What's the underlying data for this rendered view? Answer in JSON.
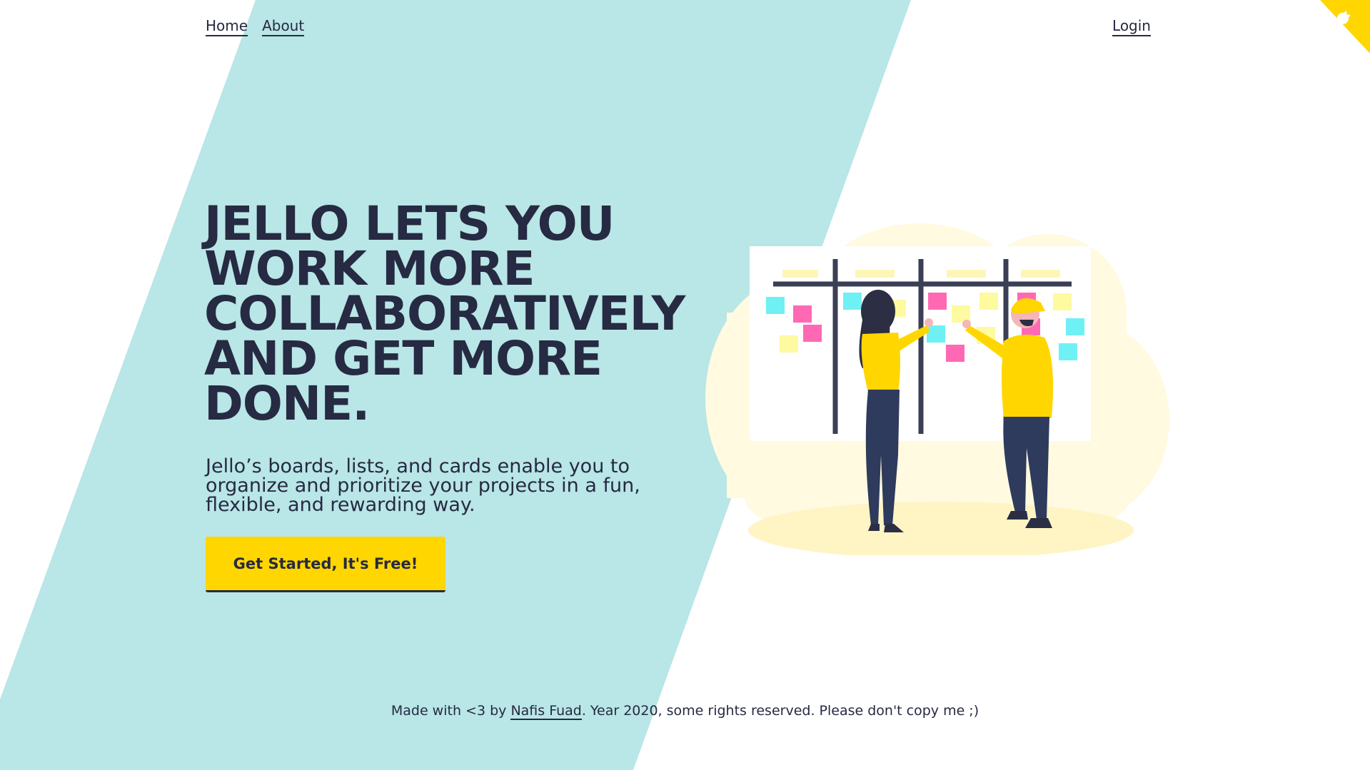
{
  "nav": {
    "home": "Home",
    "about": "About",
    "login": "Login"
  },
  "hero": {
    "title": "JELLO LETS YOU WORK MORE COLLABORATIVELY AND GET MORE DONE.",
    "description": "Jello’s boards, lists, and cards enable you to organize and prioritize your projects in a fun, flexible, and rewarding way.",
    "cta_label": "Get Started, It's Free!"
  },
  "footer": {
    "prefix": "Made with <3 by ",
    "author": "Nafis Fuad",
    "suffix": ". Year 2020, some rights reserved. Please don't copy me ;)"
  },
  "corner": {
    "icon": "github-octocat-icon"
  },
  "colors": {
    "teal": "#b9e6e6",
    "yellow": "#ffd600",
    "navy": "#262a42",
    "pink": "#ff69b4",
    "cyan": "#6ff0f5",
    "light_yellow": "#fdfaa0",
    "blob": "#fff9e0"
  }
}
